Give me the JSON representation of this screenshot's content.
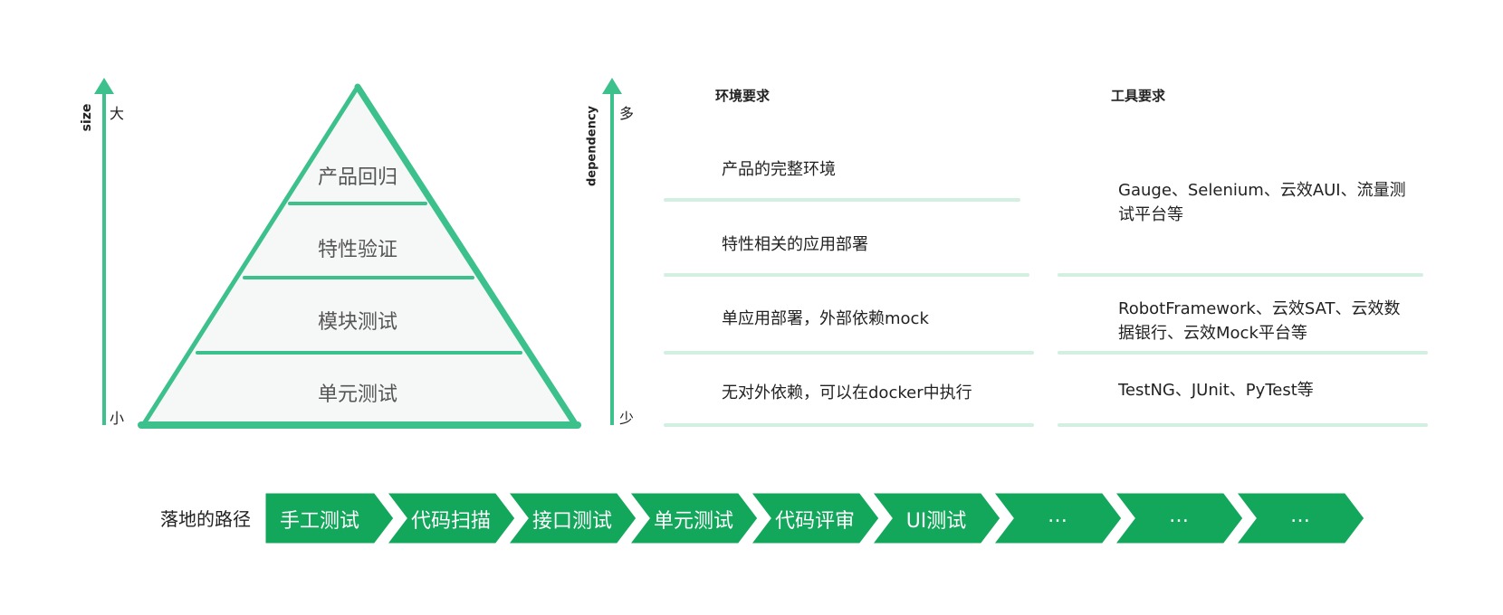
{
  "colors": {
    "pyramid_green": "#3cc08c",
    "step_green": "#12a75a",
    "divider_green": "#d3efe2",
    "pyramid_fill": "#f6f8f7"
  },
  "left_axis": {
    "label": "size",
    "top": "大",
    "bottom": "小"
  },
  "pyramid": {
    "layers": [
      "产品回归",
      "特性验证",
      "模块测试",
      "单元测试"
    ]
  },
  "dependency_axis": {
    "label": "dependency",
    "top": "多",
    "bottom": "少"
  },
  "table": {
    "env_header": "环境要求",
    "tool_header": "工具要求",
    "env_rows": [
      "产品的完整环境",
      "特性相关的应用部署",
      "单应用部署，外部依赖mock",
      "无对外依赖，可以在docker中执行"
    ],
    "tool_rows": [
      [
        "Gauge、Selenium、云效AUI、流量测",
        "试平台等"
      ],
      [
        "RobotFramework、云效SAT、云效数",
        "据银行、云效Mock平台等"
      ],
      [
        "TestNG、JUnit、PyTest等"
      ]
    ]
  },
  "path": {
    "label": "落地的路径",
    "steps": [
      "手工测试",
      "代码扫描",
      "接口测试",
      "单元测试",
      "代码评审",
      "UI测试",
      "…",
      "…",
      "…"
    ]
  }
}
